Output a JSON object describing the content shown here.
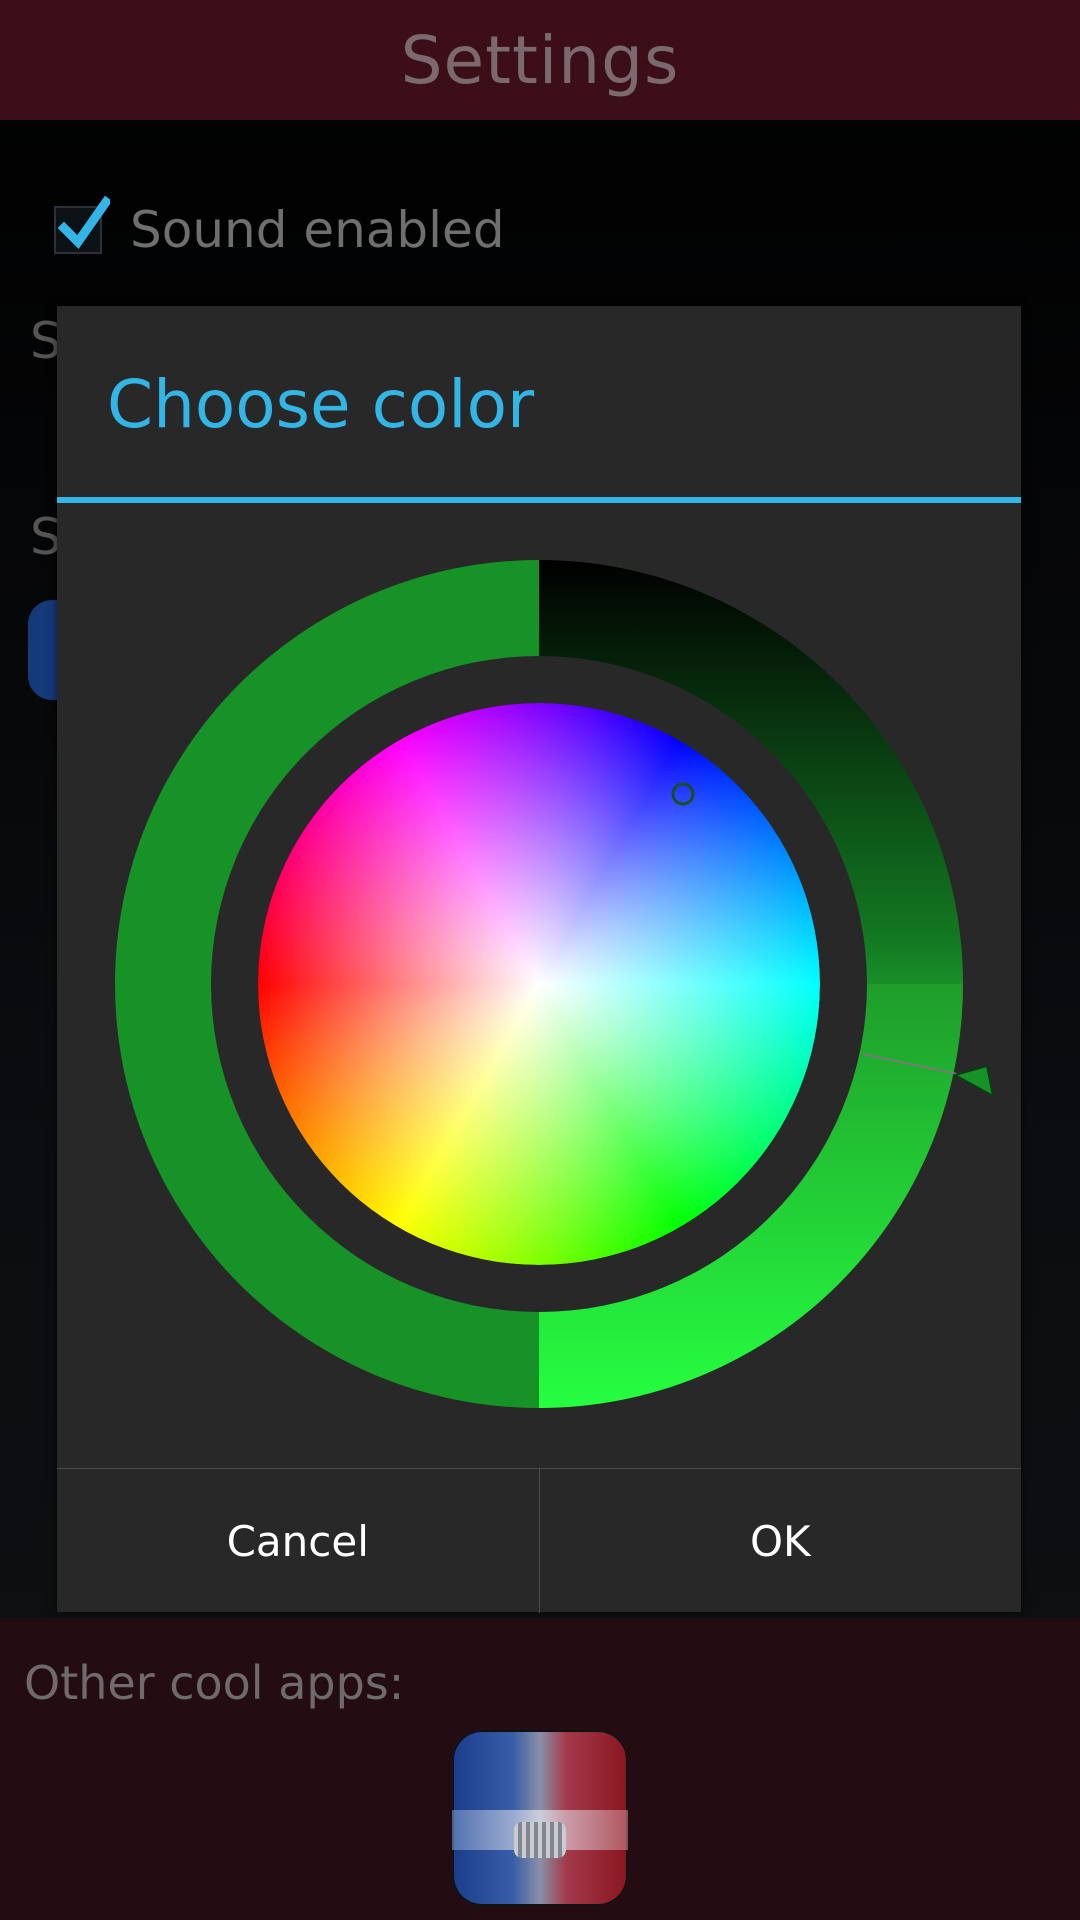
{
  "header": {
    "title": "Settings"
  },
  "settings": {
    "sound_label": "Sound enabled",
    "sound_checked": true,
    "peek_letter_1": "S",
    "peek_letter_2": "S"
  },
  "dialog": {
    "title": "Choose color",
    "cancel_label": "Cancel",
    "ok_label": "OK",
    "accent_color": "#33b5e5",
    "selected_color": "#1a8f27"
  },
  "footer": {
    "title": "Other cool apps:"
  }
}
